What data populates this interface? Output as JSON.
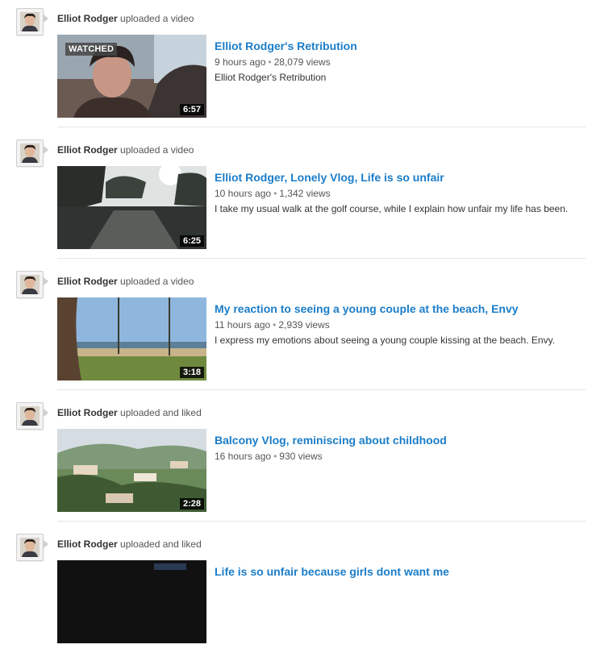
{
  "feed": {
    "items": [
      {
        "user": "Elliot Rodger",
        "action": "uploaded a video",
        "badge": "WATCHED",
        "duration": "6:57",
        "title": "Elliot Rodger's Retribution",
        "time": "9 hours ago",
        "views": "28,079 views",
        "description": "Elliot Rodger's Retribution"
      },
      {
        "user": "Elliot Rodger",
        "action": "uploaded a video",
        "duration": "6:25",
        "title": "Elliot Rodger, Lonely Vlog, Life is so unfair",
        "time": "10 hours ago",
        "views": "1,342 views",
        "description": "I take my usual walk at the golf course, while I explain how unfair my life has been."
      },
      {
        "user": "Elliot Rodger",
        "action": "uploaded a video",
        "duration": "3:18",
        "title": "My reaction to seeing a young couple at the beach, Envy",
        "time": "11 hours ago",
        "views": "2,939 views",
        "description": "I express my emotions about seeing a young couple kissing at the beach. Envy."
      },
      {
        "user": "Elliot Rodger",
        "action": "uploaded and liked",
        "duration": "2:28",
        "title": "Balcony Vlog, reminiscing about childhood",
        "time": "16 hours ago",
        "views": "930 views"
      },
      {
        "user": "Elliot Rodger",
        "action": "uploaded and liked",
        "title": "Life is so unfair because girls dont want me"
      }
    ],
    "separator": "•"
  }
}
